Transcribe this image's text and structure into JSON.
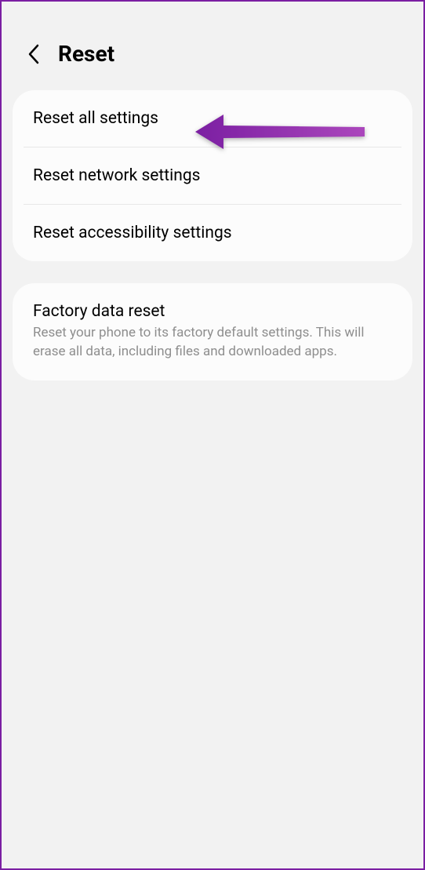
{
  "header": {
    "title": "Reset"
  },
  "group1": {
    "items": [
      {
        "label": "Reset all settings"
      },
      {
        "label": "Reset network settings"
      },
      {
        "label": "Reset accessibility settings"
      }
    ]
  },
  "group2": {
    "items": [
      {
        "label": "Factory data reset",
        "description": "Reset your phone to its factory default settings. This will erase all data, including files and downloaded apps."
      }
    ]
  },
  "annotation": {
    "color": "#8e24aa"
  }
}
